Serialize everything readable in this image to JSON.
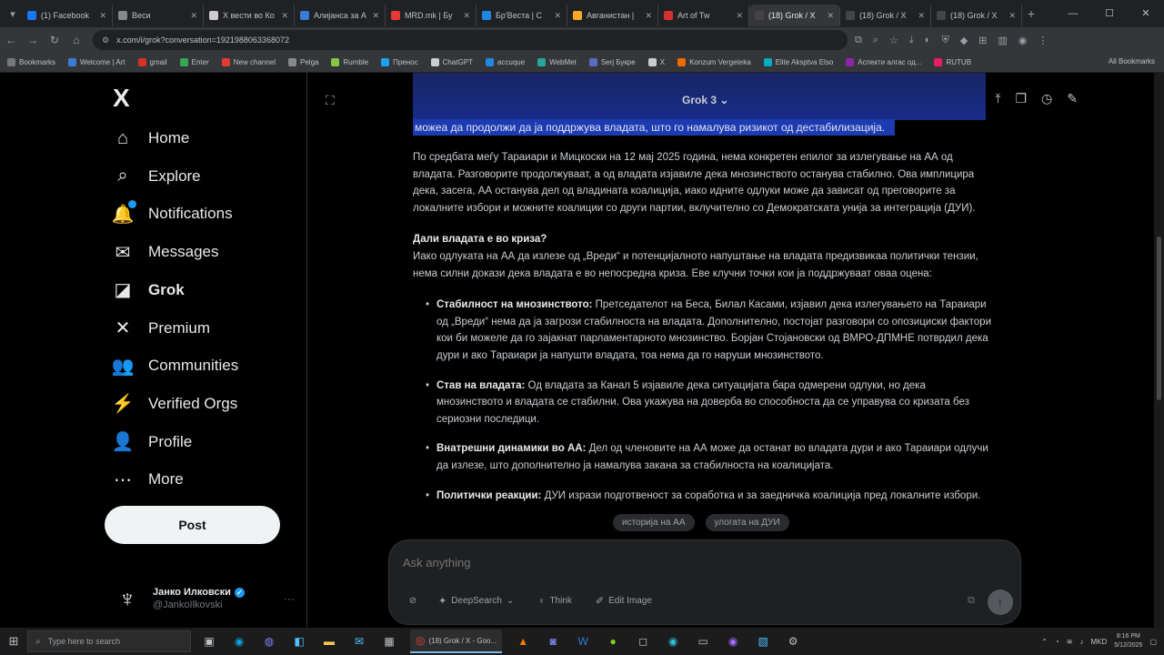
{
  "browser": {
    "tabs": [
      {
        "label": "(1) Facebook",
        "color": "#1877f2"
      },
      {
        "label": "Веси",
        "color": "#888888"
      },
      {
        "label": "Х вести во Ко",
        "color": "#cccccc"
      },
      {
        "label": "Алијанса за А",
        "color": "#3a7bd5"
      },
      {
        "label": "MRD.mk | Бу",
        "color": "#e53935"
      },
      {
        "label": "Бр'Веста | С",
        "color": "#1e88e5"
      },
      {
        "label": "Авганистан |",
        "color": "#f9a825"
      },
      {
        "label": "Art of Tw",
        "color": "#d32f2f"
      },
      {
        "label": "(18) Grok / X",
        "color": "#444444",
        "active": true
      },
      {
        "label": "(18) Grok / X",
        "color": "#444444"
      },
      {
        "label": "(18) Grok / X",
        "color": "#444444"
      }
    ],
    "new_tab": "+",
    "url": "x.com/i/grok?conversation=1921988063368072",
    "bookmarks": [
      {
        "label": "Bookmarks",
        "color": "#777777"
      },
      {
        "label": "Welcome | Art",
        "color": "#3a7bd5"
      },
      {
        "label": "gmail",
        "color": "#d93025"
      },
      {
        "label": "Enter",
        "color": "#34a853"
      },
      {
        "label": "New channel",
        "color": "#e53935"
      },
      {
        "label": "Pelga",
        "color": "#888888"
      },
      {
        "label": "Rumble",
        "color": "#85c742"
      },
      {
        "label": "Пренос",
        "color": "#1da1f2"
      },
      {
        "label": "ChatGPT",
        "color": "#cccccc"
      },
      {
        "label": "accuque",
        "color": "#1e88e5"
      },
      {
        "label": "WebMet",
        "color": "#26a69a"
      },
      {
        "label": "Serj Букре",
        "color": "#5c6bc0"
      },
      {
        "label": "X",
        "color": "#cccccc"
      },
      {
        "label": "Konzum Vergeteka",
        "color": "#ef6c00"
      },
      {
        "label": "Elite Aksptva Elso",
        "color": "#00acc1"
      },
      {
        "label": "Аспекти алгас од...",
        "color": "#8e24aa"
      },
      {
        "label": "RUTUB",
        "color": "#e91e63"
      }
    ],
    "all_bookmarks": "All Bookmarks"
  },
  "nav": {
    "logo": "X",
    "items": [
      {
        "label": "Home",
        "icon": "⌂",
        "name": "home"
      },
      {
        "label": "Explore",
        "icon": "⌕",
        "name": "explore"
      },
      {
        "label": "Notifications",
        "icon": "🔔",
        "name": "notifications"
      },
      {
        "label": "Messages",
        "icon": "✉",
        "name": "messages"
      },
      {
        "label": "Grok",
        "icon": "◪",
        "name": "grok",
        "bold": true
      },
      {
        "label": "Premium",
        "icon": "✕",
        "name": "premium"
      },
      {
        "label": "Communities",
        "icon": "👥",
        "name": "communities"
      },
      {
        "label": "Verified Orgs",
        "icon": "⚡",
        "name": "verified-orgs"
      },
      {
        "label": "Profile",
        "icon": "👤",
        "name": "profile"
      },
      {
        "label": "More",
        "icon": "⋯",
        "name": "more"
      }
    ],
    "post_label": "Post",
    "profile": {
      "name": "Јанко Илковски",
      "handle": "@JankoIlkovski",
      "more": "···"
    }
  },
  "grok": {
    "model": "Grok 3",
    "selected_text": "можеа да продолжи да ја поддржува владата, што го намалува ризикот од дестабилизација.",
    "paragraph1": "По средбата меѓу Тараиари и Мицкоски на 12 мај 2025 година, нема конкретен епилог за излегување на АА од владата. Разговорите продолжуваат, а од владата изјавиле дека мнозинството останува стабилно. Ова имплицира дека, засега, АА останува дел од владината коалиција, иако идните одлуки може да зависат од преговорите за локалните избори и можните коалиции со други партии, вклучително со Демократската унија за интеграција (ДУИ).",
    "heading": "Дали владата е во криза?",
    "paragraph2": "Иако одлуката на АА да излезе од „Вреди“ и потенцијалното напуштање на владата предизвикаа политички тензии, нема силни докази дека владата е во непосредна криза. Еве клучни точки кои ја поддржуваат оваа оцена:",
    "bullets": [
      {
        "title": "Стабилност на мнозинството:",
        "text": " Претседателот на Беса, Билал Касами, изјавил дека излегувањето на Тараиари од „Вреди“ нема да ја загрози стабилноста на владата. Дополнително, постојат разговори со опозициски фактори кои би можеле да го зајакнат парламентарното мнозинство. Борјан Стојановски од ВМРО-ДПМНЕ потврдил дека дури и ако Тараиари ја напушти владата, тоа нема да го наруши мнозинството."
      },
      {
        "title": "Став на владата:",
        "text": " Од владата за Канал 5 изјавиле дека ситуацијата бара одмерени одлуки, но дека мнозинството и владата се стабилни. Ова укажува на доверба во способноста да се управува со кризата без сериозни последици."
      },
      {
        "title": "Внатрешни динамики во АА:",
        "text": " Дел од членовите на АА може да останат во владата дури и ако Тараиари одлучи да излезе, што дополнително ја намалува закана за стабилноста на коалицијата."
      },
      {
        "title": "Политички реакции:",
        "text": " ДУИ изрази подготвеност за соработка и за заедничка коалиција пред локалните избори."
      }
    ],
    "suggestions": [
      "историја на АА",
      "улогата на ДУИ"
    ],
    "composer": {
      "placeholder": "Ask anything",
      "deepsearch": "DeepSearch",
      "think": "Think",
      "edit_image": "Edit Image"
    }
  },
  "taskbar": {
    "search_placeholder": "Type here to search",
    "active_app": "(18) Grok / X - Goo...",
    "lang": "MKD",
    "time": "8:16 PM",
    "date": "5/12/2025"
  }
}
